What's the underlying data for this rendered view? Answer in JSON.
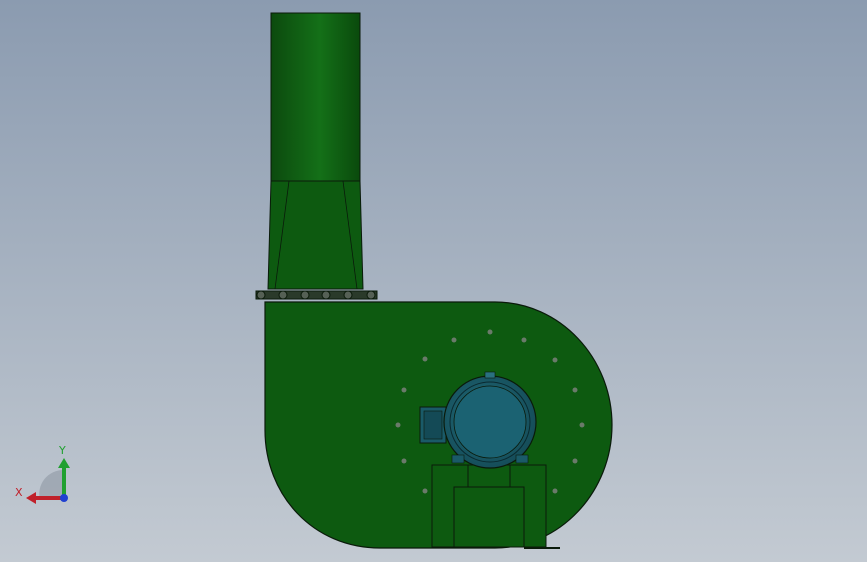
{
  "scene": {
    "background_top": "#8b9bb0",
    "background_bottom": "#c3cad2",
    "model_color": "#0e5a10",
    "model_highlight": "#1a7a1a",
    "motor_color": "#1e5f6e",
    "outline_color": "#0a1a0a"
  },
  "triad": {
    "x_label": "X",
    "y_label": "Y",
    "x_color": "#c0202a",
    "y_color": "#20a030",
    "z_color": "#2040d0"
  },
  "motor": {
    "icon": "electric-motor-icon"
  }
}
